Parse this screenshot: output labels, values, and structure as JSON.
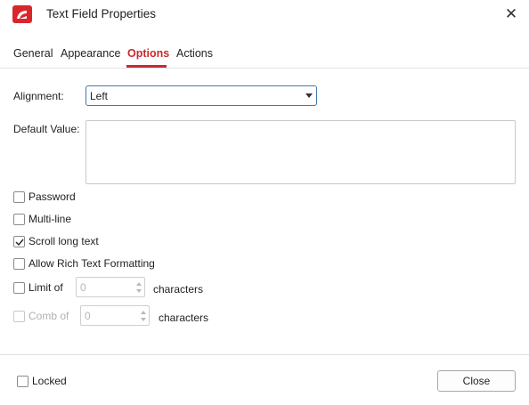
{
  "window": {
    "title": "Text Field Properties",
    "close_symbol": "✕",
    "logo_icon": "pdf-app-logo-icon",
    "accent_color": "#c72b2f"
  },
  "tabs": [
    {
      "label": "General",
      "active": false
    },
    {
      "label": "Appearance",
      "active": false
    },
    {
      "label": "Options",
      "active": true
    },
    {
      "label": "Actions",
      "active": false
    }
  ],
  "options": {
    "alignment_label": "Alignment:",
    "alignment_value": "Left",
    "default_value_label": "Default Value:",
    "default_value": "",
    "checkboxes": [
      {
        "label": "Password",
        "checked": false,
        "enabled": true
      },
      {
        "label": "Multi-line",
        "checked": false,
        "enabled": true
      },
      {
        "label": "Scroll long text",
        "checked": true,
        "enabled": true
      },
      {
        "label": "Allow Rich Text Formatting",
        "checked": false,
        "enabled": true
      }
    ],
    "limit": {
      "label": "Limit of",
      "value": "0",
      "suffix": "characters",
      "checked": false,
      "enabled": true
    },
    "comb": {
      "label": "Comb of",
      "value": "0",
      "suffix": "characters",
      "checked": false,
      "enabled": false
    }
  },
  "footer": {
    "locked_label": "Locked",
    "locked_checked": false,
    "close_button": "Close"
  }
}
